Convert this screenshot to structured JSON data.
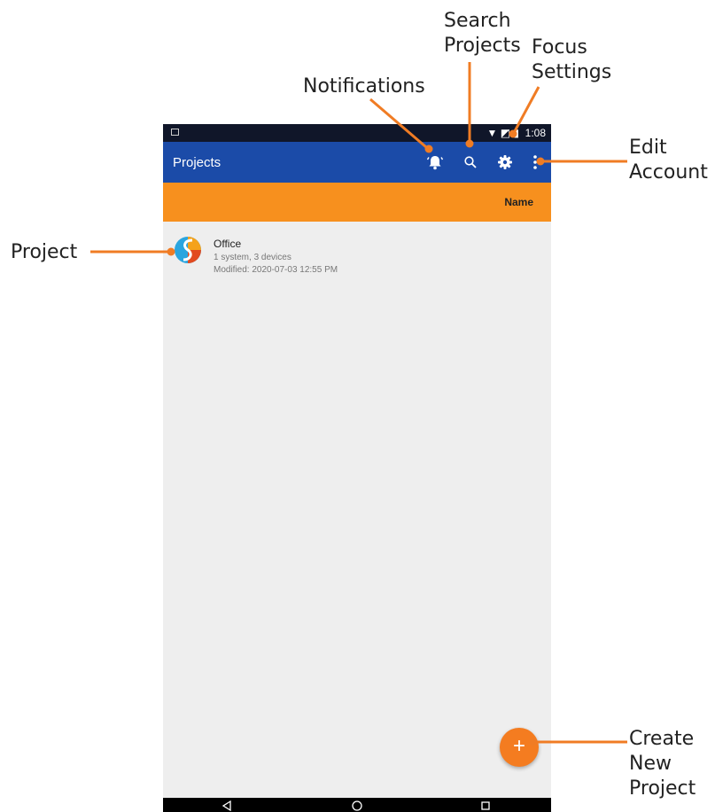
{
  "callouts": {
    "search": "Search\nProjects",
    "focus": "Focus\nSettings",
    "notifications": "Notifications",
    "edit_account": "Edit\nAccount",
    "project": "Project",
    "create": "Create\nNew\nProject"
  },
  "status_bar": {
    "time": "1:08"
  },
  "app_bar": {
    "title": "Projects"
  },
  "sort_bar": {
    "label": "Name"
  },
  "project": {
    "name": "Office",
    "summary": "1 system, 3 devices",
    "modified": "Modified: 2020-07-03 12:55 PM"
  },
  "fab": {
    "label": "+"
  },
  "icons": {
    "notifications": "bell-alert-icon",
    "search": "search-icon",
    "settings": "gear-icon",
    "more": "more-vert-icon",
    "back": "back-triangle-icon",
    "home": "home-circle-icon",
    "recents": "recents-square-icon"
  },
  "colors": {
    "app_bar": "#1b4ba8",
    "status_bar": "#101629",
    "sort_bar": "#f7901e",
    "accent": "#f47c20",
    "background": "#eeeeee"
  }
}
